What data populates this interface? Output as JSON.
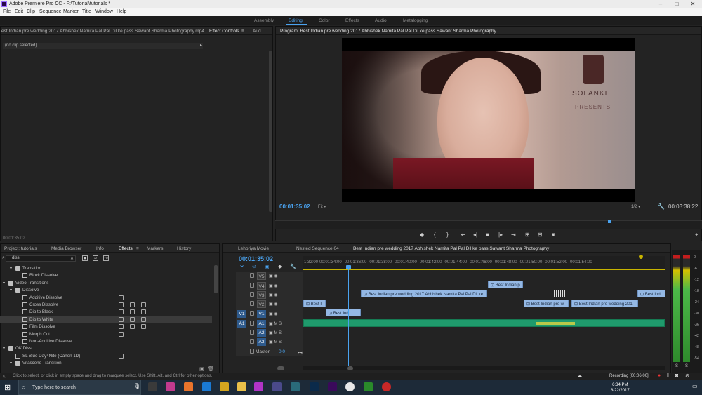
{
  "app": {
    "title": "Adobe Premiere Pro CC - F:\\Tutorial\\tutorials *"
  },
  "menu": [
    "File",
    "Edit",
    "Clip",
    "Sequence",
    "Marker",
    "Title",
    "Window",
    "Help"
  ],
  "workspaces": {
    "items": [
      "Assembly",
      "Editing",
      "Color",
      "Effects",
      "Audio",
      "Metalogging"
    ],
    "active": "Editing"
  },
  "source": {
    "tab_label": "est Indian pre wedding 2017  Abhishek  Namita  Pal Pal Dil ke pass  Sawant Sharma Photography.mp4",
    "effect_controls": "Effect Controls",
    "audio_tab": "Aud",
    "no_clip": "(no clip selected)",
    "timecode": "00:01:35:02"
  },
  "program": {
    "title": "Program: Best Indian pre wedding 2017  Abhishek  Namita  Pal Pal Dil ke pass  Sawant Sharma Photography",
    "timecode": "00:01:35:02",
    "fit": "Fit",
    "fraction": "1/2",
    "duration": "00:03:38:22",
    "watermark_line1": "SOLANKI",
    "watermark_line2": "PRESENTS"
  },
  "effects_panel": {
    "tabs": [
      "Project: tutorials",
      "Media Browser",
      "Info",
      "Effects",
      "Markers",
      "History"
    ],
    "active_tab": "Effects",
    "search": "diss",
    "rows": [
      {
        "label": "Transition",
        "indent": 1,
        "kind": "folder"
      },
      {
        "label": "Block Dissolve",
        "indent": 2,
        "kind": "fx",
        "badges": 0
      },
      {
        "label": "Video Transitions",
        "indent": 0,
        "kind": "folder"
      },
      {
        "label": "Dissolve",
        "indent": 1,
        "kind": "folder"
      },
      {
        "label": "Additive Dissolve",
        "indent": 2,
        "kind": "fx",
        "badges": 1
      },
      {
        "label": "Cross Dissolve",
        "indent": 2,
        "kind": "fx",
        "badges": 3
      },
      {
        "label": "Dip to Black",
        "indent": 2,
        "kind": "fx",
        "badges": 3
      },
      {
        "label": "Dip to White",
        "indent": 2,
        "kind": "fx",
        "badges": 3,
        "selected": true
      },
      {
        "label": "Film Dissolve",
        "indent": 2,
        "kind": "fx",
        "badges": 3
      },
      {
        "label": "Morph Cut",
        "indent": 2,
        "kind": "fx",
        "badges": 1
      },
      {
        "label": "Non-Additive Dissolve",
        "indent": 2,
        "kind": "fx",
        "badges": 0
      },
      {
        "label": "OK Diss",
        "indent": 0,
        "kind": "folder"
      },
      {
        "label": "SL Blue Day4Nite (Canon 1D)",
        "indent": 1,
        "kind": "fx",
        "badges": 1
      },
      {
        "label": "Vitascene Transition",
        "indent": 1,
        "kind": "folder"
      }
    ]
  },
  "timeline": {
    "tabs": [
      "Lehoriya Movie",
      "Nested Sequence 04",
      "Best Indian pre wedding 2017  Abhishek  Namita  Pal Pal Dil ke pass  Sawant Sharma Photography"
    ],
    "timecode": "00:01:35:02",
    "ruler": [
      "1:32:00",
      "00:01:34:00",
      "00:01:36:00",
      "00:01:38:00",
      "00:01:40:00",
      "00:01:42:00",
      "00:01:44:00",
      "00:01:46:00",
      "00:01:48:00",
      "00:01:50:00",
      "00:01:52:00",
      "00:01:54:00"
    ],
    "tracks": [
      {
        "name": "V5",
        "type": "video"
      },
      {
        "name": "V4",
        "type": "video"
      },
      {
        "name": "V3",
        "type": "video"
      },
      {
        "name": "V2",
        "type": "video"
      },
      {
        "name": "V1",
        "type": "video",
        "src": "V1"
      },
      {
        "name": "A1",
        "type": "audio",
        "src": "A1"
      },
      {
        "name": "A2",
        "type": "audio"
      },
      {
        "name": "A3",
        "type": "audio"
      },
      {
        "name": "Master",
        "type": "master",
        "value": "0.0"
      }
    ],
    "clip_labels": {
      "v3_main": "Best Indian pre wedding 2017  Abhishek  Namita  Pal Pal Dil ke",
      "v3_right": "Best Indian p",
      "v3_far": "Best Indi",
      "v2_left": "Best I",
      "v2_mid": "Best Indian pre w",
      "v2_main": "Best Indian pre wedding 201",
      "v1": "Best Ind"
    }
  },
  "meters": {
    "scale": [
      "0",
      "-6",
      "-12",
      "-18",
      "-24",
      "-30",
      "-36",
      "-42",
      "-48",
      "-54"
    ],
    "bottom": [
      "S",
      "S"
    ]
  },
  "status": "Click to select, or click in empty space and drag to marquee select. Use Shift, Alt, and Ctrl for other options.",
  "recording": "Recording [00:06:00]",
  "taskbar": {
    "search": "Type here to search",
    "time": "6:34 PM",
    "date": "8/22/2017"
  }
}
